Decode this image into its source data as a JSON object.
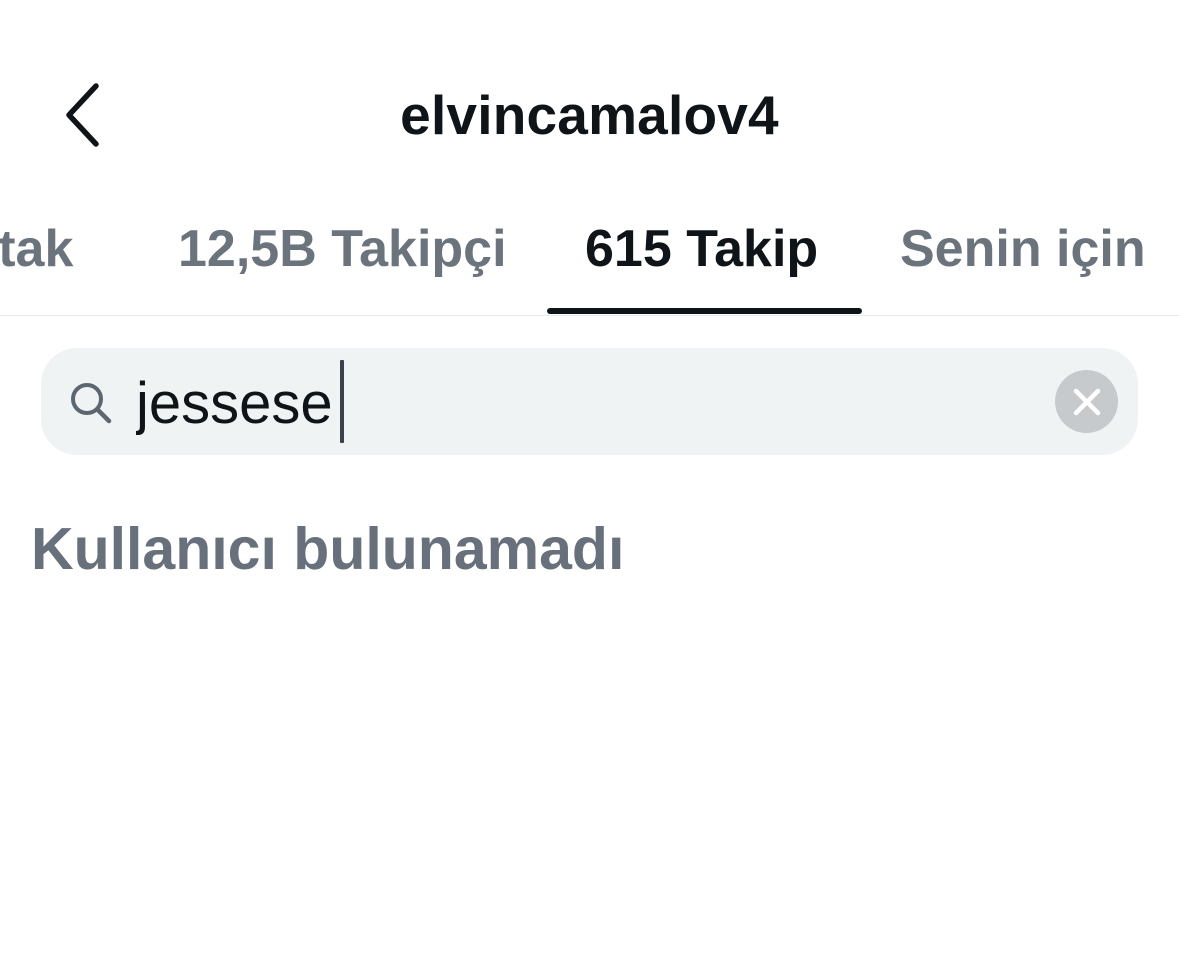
{
  "header": {
    "title": "elvincamalov4",
    "back_icon": "chevron-left-icon"
  },
  "tabs": [
    {
      "label": "Ortak",
      "visible_text": "rtak",
      "active": false
    },
    {
      "label": "12,5B Takipçi",
      "active": false
    },
    {
      "label": "615 Takip",
      "active": true
    },
    {
      "label": "Senin için",
      "active": false
    }
  ],
  "search": {
    "icon": "search-icon",
    "value": "jessese",
    "clear_icon": "close-icon"
  },
  "empty_state": {
    "message": "Kullanıcı bulunamadı"
  },
  "colors": {
    "text_primary": "#0f1419",
    "text_secondary": "#6b737c",
    "search_background": "#eff3f4",
    "clear_button": "#c7cacd",
    "divider": "#e7e9ea"
  }
}
